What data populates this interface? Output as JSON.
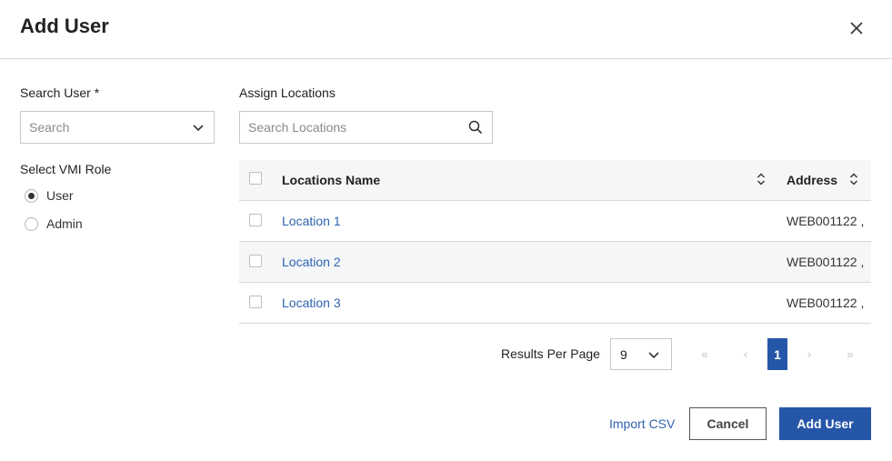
{
  "dialog": {
    "title": "Add User",
    "close_icon": "close-icon"
  },
  "left": {
    "search_user_label": "Search User *",
    "search_user_placeholder": "Search",
    "search_user_value": "",
    "role_label": "Select VMI Role",
    "roles": [
      {
        "label": "User",
        "selected": true
      },
      {
        "label": "Admin",
        "selected": false
      }
    ]
  },
  "locations": {
    "label": "Assign Locations",
    "search_placeholder": "Search Locations",
    "search_value": "",
    "columns": {
      "name": "Locations Name",
      "address": "Address"
    },
    "rows": [
      {
        "name": "Location 1",
        "address": "WEB001122 ,",
        "checked": false
      },
      {
        "name": "Location 2",
        "address": "WEB001122 ,",
        "checked": false
      },
      {
        "name": "Location 3",
        "address": "WEB001122 ,",
        "checked": false
      }
    ]
  },
  "pagination": {
    "results_per_page_label": "Results Per Page",
    "results_per_page_value": "9",
    "first": "«",
    "prev": "‹",
    "current_page": "1",
    "next": "›",
    "last": "»"
  },
  "footer": {
    "import_label": "Import CSV",
    "cancel_label": "Cancel",
    "add_label": "Add User"
  },
  "colors": {
    "primary": "#2656a8",
    "link": "#2e63b0",
    "border": "#c8c8c8",
    "header_bg": "#f5f6f7"
  }
}
